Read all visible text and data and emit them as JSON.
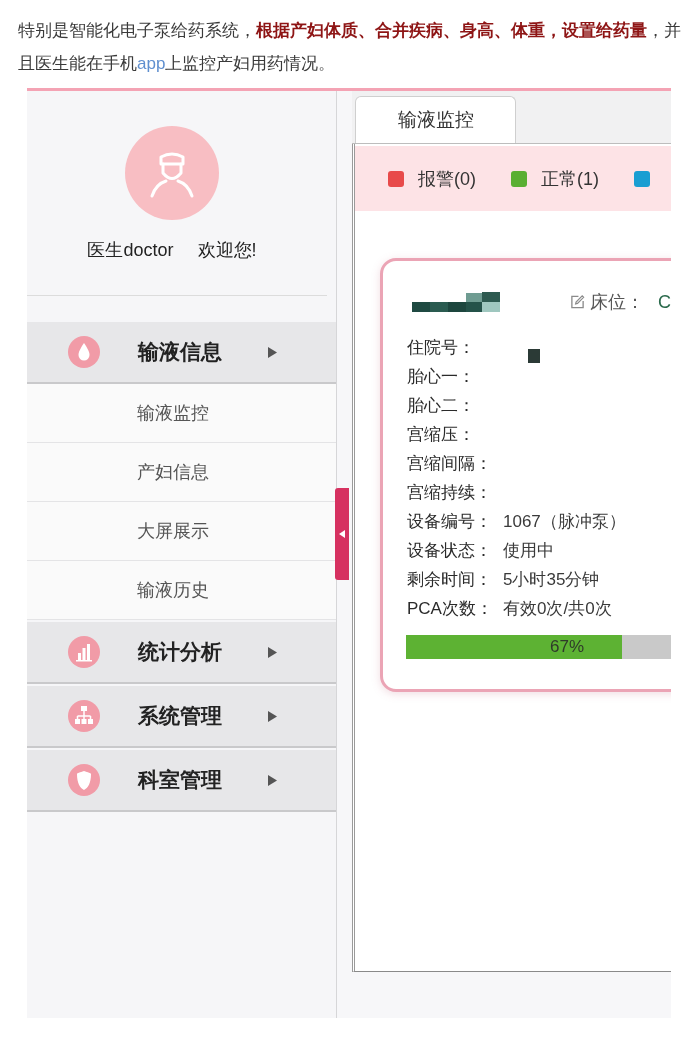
{
  "intro": {
    "segments": [
      {
        "kind": "plain",
        "text": "特别是智能化电子泵给药系统，"
      },
      {
        "kind": "emphasis",
        "text": "根据产妇体质、合并疾病、身高、体重，设置给药量"
      },
      {
        "kind": "plain",
        "text": "，并且医生能在手机"
      },
      {
        "kind": "link",
        "text": "app"
      },
      {
        "kind": "plain",
        "text": "上监控产妇用药情况。"
      }
    ]
  },
  "sidebar": {
    "user": {
      "name": "医生doctor",
      "greeting": "欢迎您!"
    },
    "menu": [
      {
        "label": "输液信息",
        "children": [
          {
            "label": "输液监控"
          },
          {
            "label": "产妇信息"
          },
          {
            "label": "大屏展示"
          },
          {
            "label": "输液历史"
          }
        ]
      },
      {
        "label": "统计分析"
      },
      {
        "label": "系统管理"
      },
      {
        "label": "科室管理"
      }
    ]
  },
  "tabs": [
    {
      "label": "输液监控",
      "selected": true
    }
  ],
  "legend": [
    {
      "label": "报警(0)",
      "color": "#e84a4a"
    },
    {
      "label": "正常(1)",
      "color": "#5aaf32"
    },
    {
      "color": "#1a9ed2"
    }
  ],
  "device_card": {
    "bed_label": "床位：",
    "bed_value": "C",
    "fields": [
      {
        "label": "住院号："
      },
      {
        "label": "胎心一："
      },
      {
        "label": "胎心二："
      },
      {
        "label": "宫缩压："
      },
      {
        "label": "宫缩间隔："
      },
      {
        "label": "宫缩持续："
      },
      {
        "label": "设备编号：",
        "value": "1067（脉冲泵）"
      },
      {
        "label": "设备状态：",
        "value": "使用中"
      },
      {
        "label": "剩余时间：",
        "value": "5小时35分钟"
      },
      {
        "label": "PCA次数：",
        "value": "有效0次/共0次"
      }
    ],
    "progress": {
      "level": 0.67,
      "reading": "67%"
    }
  }
}
